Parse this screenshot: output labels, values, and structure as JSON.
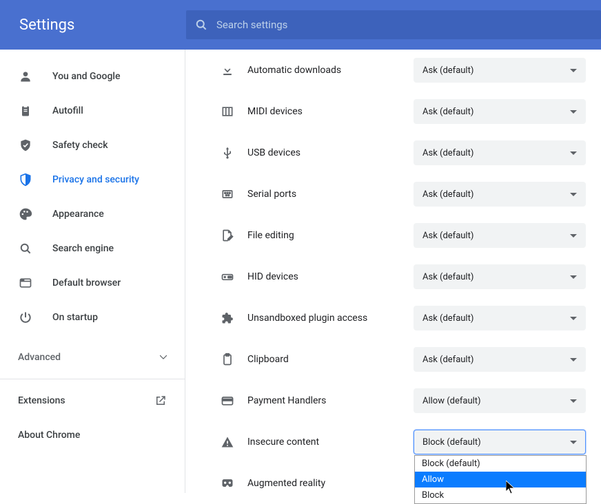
{
  "header": {
    "title": "Settings",
    "search_placeholder": "Search settings"
  },
  "sidebar": {
    "items": [
      {
        "icon": "person",
        "label": "You and Google",
        "active": false
      },
      {
        "icon": "clipboard",
        "label": "Autofill",
        "active": false
      },
      {
        "icon": "shield-check",
        "label": "Safety check",
        "active": false
      },
      {
        "icon": "shield",
        "label": "Privacy and security",
        "active": true
      },
      {
        "icon": "palette",
        "label": "Appearance",
        "active": false
      },
      {
        "icon": "search",
        "label": "Search engine",
        "active": false
      },
      {
        "icon": "browser",
        "label": "Default browser",
        "active": false
      },
      {
        "icon": "power",
        "label": "On startup",
        "active": false
      }
    ],
    "advanced_label": "Advanced",
    "extensions_label": "Extensions",
    "about_label": "About Chrome"
  },
  "permissions": [
    {
      "icon": "download",
      "label": "Automatic downloads",
      "value": "Ask (default)"
    },
    {
      "icon": "midi",
      "label": "MIDI devices",
      "value": "Ask (default)"
    },
    {
      "icon": "usb",
      "label": "USB devices",
      "value": "Ask (default)"
    },
    {
      "icon": "serial",
      "label": "Serial ports",
      "value": "Ask (default)"
    },
    {
      "icon": "file-edit",
      "label": "File editing",
      "value": "Ask (default)"
    },
    {
      "icon": "hid",
      "label": "HID devices",
      "value": "Ask (default)"
    },
    {
      "icon": "puzzle",
      "label": "Unsandboxed plugin access",
      "value": "Ask (default)"
    },
    {
      "icon": "clipboard-o",
      "label": "Clipboard",
      "value": "Ask (default)"
    },
    {
      "icon": "card",
      "label": "Payment Handlers",
      "value": "Allow (default)"
    },
    {
      "icon": "warning",
      "label": "Insecure content",
      "value": "Block (default)",
      "open": true,
      "options": [
        "Block (default)",
        "Allow",
        "Block"
      ],
      "highlight": "Allow"
    },
    {
      "icon": "vr",
      "label": "Augmented reality",
      "value": ""
    }
  ]
}
